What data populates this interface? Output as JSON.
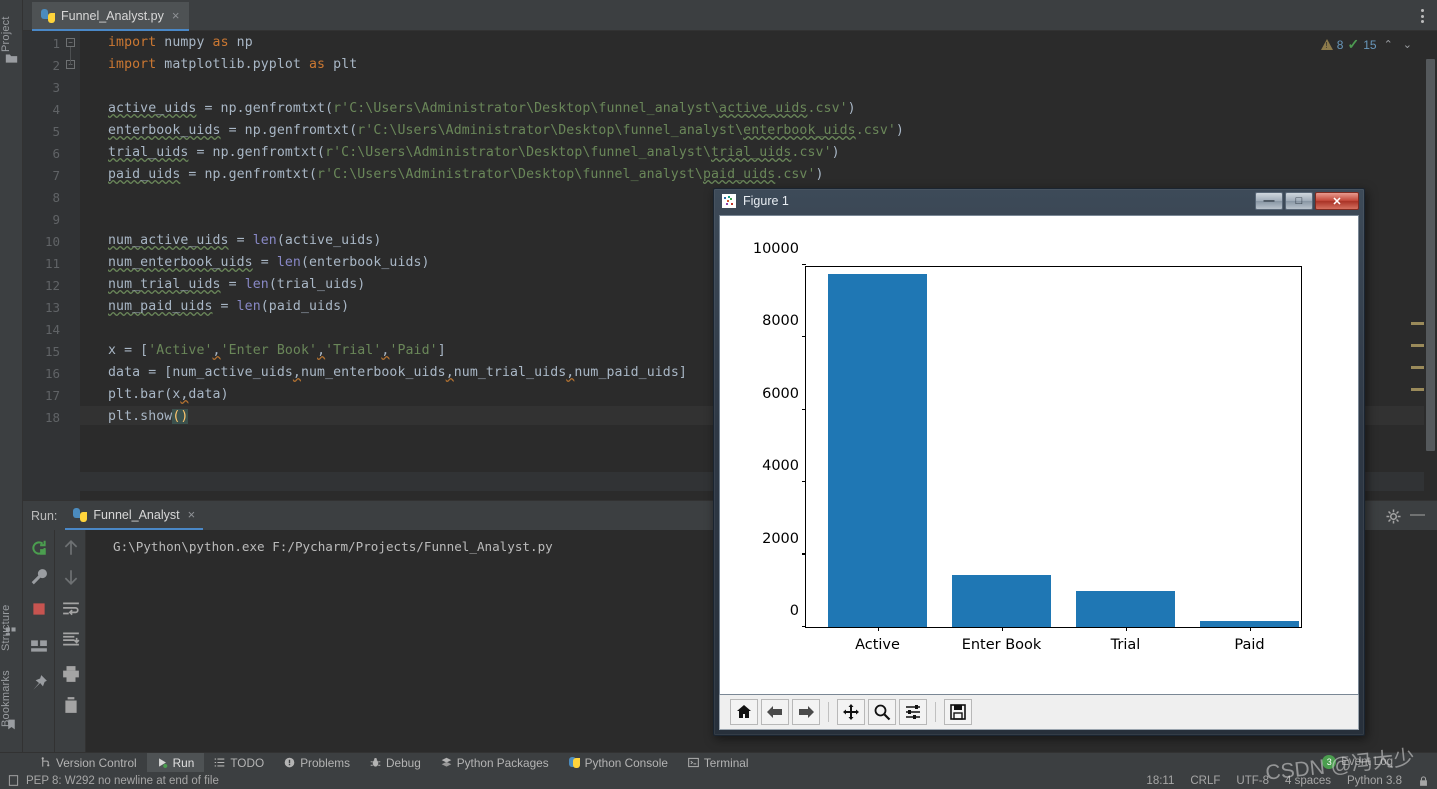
{
  "ide": {
    "left_rail": {
      "project_label": "Project",
      "structure_label": "Structure",
      "bookmarks_label": "Bookmarks"
    },
    "tab": {
      "filename": "Funnel_Analyst.py",
      "close_glyph": "×",
      "icon": "python-file-icon"
    },
    "inspection": {
      "warning_count": "8",
      "check_count": "15",
      "up_glyph": "⌃",
      "down_glyph": "⌄"
    },
    "editor": {
      "line_numbers": [
        "1",
        "2",
        "3",
        "4",
        "5",
        "6",
        "7",
        "8",
        "9",
        "10",
        "11",
        "12",
        "13",
        "14",
        "15",
        "16",
        "17",
        "18"
      ],
      "lines": [
        {
          "n": "1",
          "text": "import numpy as np"
        },
        {
          "n": "2",
          "text": "import matplotlib.pyplot as plt"
        },
        {
          "n": "3",
          "text": ""
        },
        {
          "n": "4",
          "text": "active_uids = np.genfromtxt(r'C:\\Users\\Administrator\\Desktop\\funnel_analyst\\active_uids.csv')"
        },
        {
          "n": "5",
          "text": "enterbook_uids = np.genfromtxt(r'C:\\Users\\Administrator\\Desktop\\funnel_analyst\\enterbook_uids.csv')"
        },
        {
          "n": "6",
          "text": "trial_uids = np.genfromtxt(r'C:\\Users\\Administrator\\Desktop\\funnel_analyst\\trial_uids.csv')"
        },
        {
          "n": "7",
          "text": "paid_uids = np.genfromtxt(r'C:\\Users\\Administrator\\Desktop\\funnel_analyst\\paid_uids.csv')"
        },
        {
          "n": "8",
          "text": ""
        },
        {
          "n": "9",
          "text": ""
        },
        {
          "n": "10",
          "text": "num_active_uids = len(active_uids)"
        },
        {
          "n": "11",
          "text": "num_enterbook_uids = len(enterbook_uids)"
        },
        {
          "n": "12",
          "text": "num_trial_uids = len(trial_uids)"
        },
        {
          "n": "13",
          "text": "num_paid_uids = len(paid_uids)"
        },
        {
          "n": "14",
          "text": ""
        },
        {
          "n": "15",
          "text": "x = ['Active','Enter Book','Trial','Paid']"
        },
        {
          "n": "16",
          "text": "data = [num_active_uids,num_enterbook_uids,num_trial_uids,num_paid_uids]"
        },
        {
          "n": "17",
          "text": "plt.bar(x,data)"
        },
        {
          "n": "18",
          "text": "plt.show()"
        }
      ]
    },
    "run_panel": {
      "label": "Run:",
      "tab_name": "Funnel_Analyst",
      "tab_close": "×",
      "console_line": "G:\\Python\\python.exe F:/Pycharm/Projects/Funnel_Analyst.py",
      "buttons": [
        "rerun-icon",
        "wrench-icon",
        "stop-icon",
        "layout-icon",
        "pin-icon",
        "scroll-up-icon",
        "scroll-down-icon",
        "soft-wrap-icon",
        "scroll-end-icon",
        "print-icon",
        "trash-icon"
      ],
      "gear": "gear-icon",
      "minimize": "—"
    },
    "bottom_tabs": [
      {
        "label": "Version Control",
        "icon": "branch-icon",
        "active": false
      },
      {
        "label": "Run",
        "icon": "run-play-icon",
        "active": true
      },
      {
        "label": "TODO",
        "icon": "todo-list-icon",
        "active": false
      },
      {
        "label": "Problems",
        "icon": "problems-icon",
        "active": false
      },
      {
        "label": "Debug",
        "icon": "debug-bug-icon",
        "active": false
      },
      {
        "label": "Python Packages",
        "icon": "packages-icon",
        "active": false
      },
      {
        "label": "Python Console",
        "icon": "python-console-icon",
        "active": false
      },
      {
        "label": "Terminal",
        "icon": "terminal-icon",
        "active": false
      }
    ],
    "status_bar": {
      "message": "PEP 8: W292 no newline at end of file",
      "message_icon": "document-icon",
      "time": "18:11",
      "line_ending": "CRLF",
      "encoding": "UTF-8",
      "indent": "4 spaces",
      "interpreter": "Python 3.8",
      "lock_icon": "lock-icon",
      "event_log": "Event Log",
      "event_count": "3"
    },
    "watermark": "CSDN @冯大少"
  },
  "figure_window": {
    "title": "Figure 1",
    "icon": "matplotlib-icon",
    "window_buttons": {
      "minimize": "—",
      "maximize": "□",
      "close": "✕"
    },
    "toolbar": [
      {
        "name": "home-icon",
        "glyph": "⌂"
      },
      {
        "name": "back-arrow-icon",
        "glyph": "⬅"
      },
      {
        "name": "forward-arrow-icon",
        "glyph": "➡"
      },
      {
        "name": "pan-move-icon",
        "glyph": "✥"
      },
      {
        "name": "zoom-magnifier-icon",
        "glyph": "⚲"
      },
      {
        "name": "configure-subplots-icon",
        "glyph": "≡"
      },
      {
        "name": "save-floppy-icon",
        "glyph": "💾"
      }
    ]
  },
  "chart_data": {
    "type": "bar",
    "title": "",
    "xlabel": "",
    "ylabel": "",
    "categories": [
      "Active",
      "Enter Book",
      "Trial",
      "Paid"
    ],
    "values": [
      9750,
      1436,
      994,
      166
    ],
    "yticks": [
      0,
      2000,
      4000,
      6000,
      8000,
      10000
    ],
    "ytick_labels": [
      "0",
      "2000",
      "4000",
      "6000",
      "8000",
      "10000"
    ],
    "ylim": [
      0,
      10000
    ],
    "bar_color": "#1f77b4",
    "grid": false,
    "legend": false
  }
}
